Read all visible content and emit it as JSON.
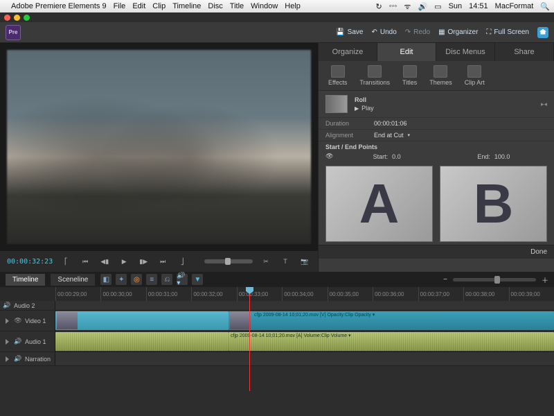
{
  "menubar": {
    "app": "Adobe Premiere Elements 9",
    "items": [
      "File",
      "Edit",
      "Clip",
      "Timeline",
      "Disc",
      "Title",
      "Window",
      "Help"
    ],
    "right": {
      "day": "Sun",
      "time": "14:51",
      "user": "MacFormat"
    }
  },
  "toolbar": {
    "save": "Save",
    "undo": "Undo",
    "redo": "Redo",
    "organizer": "Organizer",
    "fullscreen": "Full Screen"
  },
  "panel_tabs": [
    "Organize",
    "Edit",
    "Disc Menus",
    "Share"
  ],
  "panel_tab_active": "Edit",
  "subtools": [
    "Effects",
    "Transitions",
    "Titles",
    "Themes",
    "Clip Art"
  ],
  "transition": {
    "name": "Roll",
    "play": "Play",
    "duration_label": "Duration",
    "duration": "00:00:01:06",
    "align_label": "Alignment",
    "align": "End at Cut",
    "section": "Start / End Points",
    "start_label": "Start:",
    "start": "0.0",
    "end_label": "End:",
    "end": "100.0",
    "a": "A",
    "b": "B",
    "done": "Done"
  },
  "transport": {
    "timecode": "00:00:32:23"
  },
  "timeline_tabs": [
    "Timeline",
    "Sceneline"
  ],
  "ruler": [
    "00:00:29;00",
    "00:00:30;00",
    "00:00:31;00",
    "00:00:32;00",
    "00:00:33;00",
    "00:00:34;00",
    "00:00:35;00",
    "00:00:36;00",
    "00:00:37;00",
    "00:00:38;00",
    "00:00:39;00"
  ],
  "tracks": {
    "audio2": "Audio 2",
    "video1": "Video 1",
    "audio1": "Audio 1",
    "narration": "Narration"
  },
  "clips": {
    "v_label": "cfjp 2009-08-14 10;01;20.mov [V] Opacity:Clip Opacity ▾",
    "a_label": "cfjp 2009-08-14 10;01;20.mov [A] Volume:Clip Volume ▾"
  },
  "appicon": "Pre"
}
